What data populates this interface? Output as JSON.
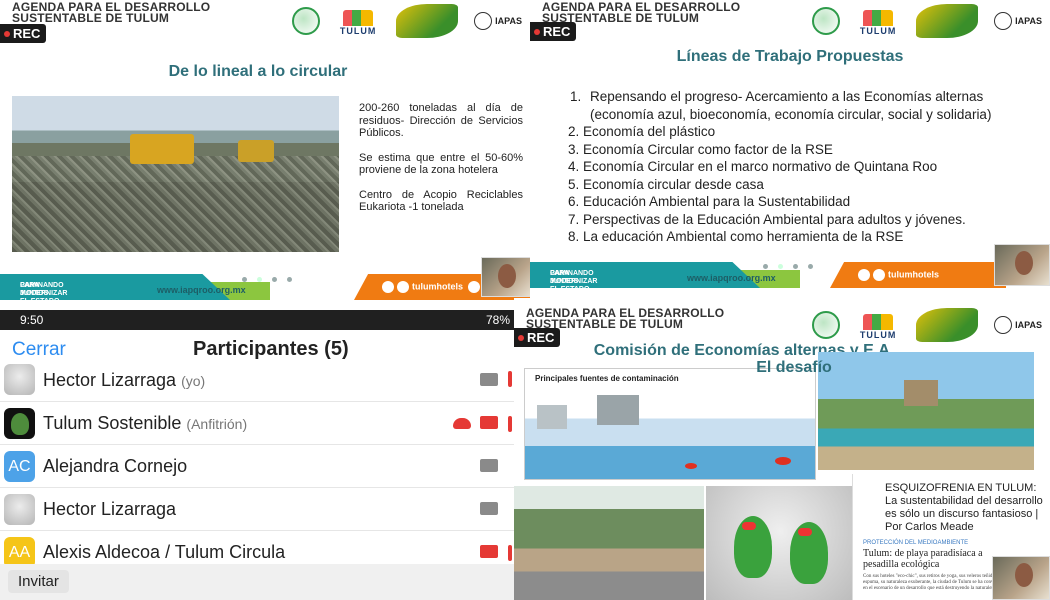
{
  "slide_header": {
    "title_line1": "AGENDA PARA EL DESARROLLO",
    "title_line2": "SUSTENTABLE DE TULUM",
    "rec_label": "REC",
    "logo_tulum": "TULUM",
    "logo_iapas": "IAPAS"
  },
  "footer": {
    "left_line1": "CAMINANDO JUNTOS",
    "left_line2": "PARA MODERNIZAR EL ESTADO",
    "url": "www.iapqroo.org.mx",
    "social_handle": "tulumhotels",
    "social_handle_short": "ww"
  },
  "slide1": {
    "title": "De lo lineal a lo circular",
    "paragraphs": [
      "200-260 toneladas al día de residuos- Dirección de Servicios Públicos.",
      "Se estima que entre el 50-60% proviene de la zona hotelera",
      "Centro de Acopio Reciclables Eukariota -1 tonelada"
    ]
  },
  "slide2": {
    "title": "Líneas de Trabajo Propuestas",
    "items": [
      {
        "num": "1.",
        "text": "Repensando el progreso- Acercamiento a las Economías alternas (economía azul, bioeconomía, economía circular, social y solidaria)"
      },
      {
        "num": "2.",
        "text": "Economía del plástico"
      },
      {
        "num": "3.",
        "text": "Economía Circular como factor de la RSE"
      },
      {
        "num": "4.",
        "text": "Economía Circular en el marco normativo de Quintana Roo"
      },
      {
        "num": "5.",
        "text": "Economía circular desde casa"
      },
      {
        "num": "6.",
        "text": "Educación Ambiental para la Sustentabilidad"
      },
      {
        "num": "7.",
        "text": "Perspectivas de la Educación Ambiental para adultos y jóvenes."
      },
      {
        "num": "8.",
        "text": "La educación Ambiental como herramienta de la RSE"
      }
    ]
  },
  "participants_panel": {
    "status_time": "9:50",
    "status_battery": "78%",
    "close_label": "Cerrar",
    "title": "Participantes (5)",
    "invite_label": "Invitar",
    "participants": [
      {
        "name": "Hector Lizarraga",
        "role": "(yo)",
        "initials": "",
        "avatar": "photo",
        "video": "on",
        "audio": "muted"
      },
      {
        "name": "Tulum Sostenible",
        "role": "(Anfitrión)",
        "initials": "",
        "avatar": "logo",
        "video": "off",
        "audio": "muted",
        "recording": true
      },
      {
        "name": "Alejandra Cornejo",
        "role": "",
        "initials": "AC",
        "avatar": "initials",
        "video": "on",
        "audio": "on"
      },
      {
        "name": "Hector Lizarraga",
        "role": "",
        "initials": "",
        "avatar": "photo",
        "video": "on",
        "audio": "on"
      },
      {
        "name": "Alexis Aldecoa / Tulum Circula",
        "role": "",
        "initials": "AA",
        "avatar": "initials",
        "video": "off",
        "audio": "muted"
      }
    ]
  },
  "slide4": {
    "title": "Comisión de Economías alternas y E.A.",
    "subtitle": "El desafío",
    "diagram_title": "Principales fuentes de contaminación",
    "news_headline": "ESQUIZOFRENIA EN TULUM: La sustentabilidad del desarrollo es sólo un discurso fantasioso | Por Carlos Meade",
    "news_tag": "PROTECCIÓN DEL MEDIOAMBIENTE",
    "news_title": "Tulum: de playa paradisíaca a pesadilla ecológica",
    "news_body": "Con sus hoteles \"eco-chic\", sus retiros de yoga, sus veleros teñidos de espuma, su naturaleza exuberante, la ciudad de Tulum se ha convertido en el escenario de un desarrollo que está destruyendo la naturaleza."
  },
  "colors": {
    "teal": "#1a9aa0",
    "green": "#8cc63f",
    "orange": "#f07b12",
    "title_teal": "#2f6f7a",
    "link_blue": "#2d8cf0",
    "alert_red": "#e53935"
  },
  "icons": [
    "rec-dot-icon",
    "globe-logo-icon",
    "leaf-logo-icon",
    "facebook-icon",
    "instagram-icon",
    "web-icon",
    "camera-icon",
    "microphone-muted-icon",
    "cloud-recording-icon"
  ]
}
